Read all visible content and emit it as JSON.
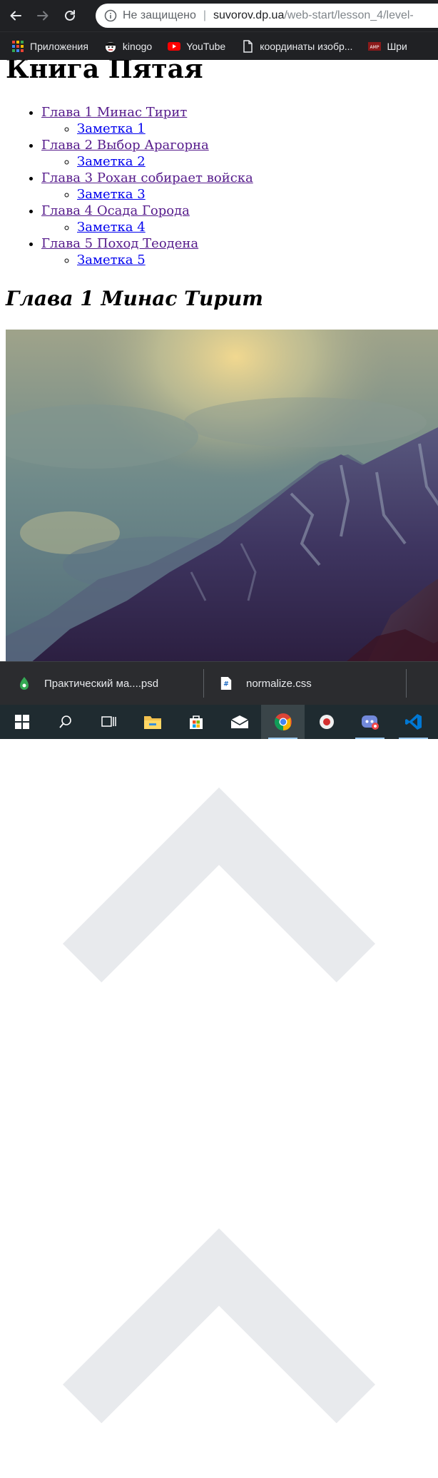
{
  "browser": {
    "security_label": "Не защищено",
    "url_host": "suvorov.dp.ua",
    "url_path": "/web-start/lesson_4/level-"
  },
  "bookmarks": [
    {
      "label": "Приложения",
      "icon": "apps-grid-icon"
    },
    {
      "label": "kinogo",
      "icon": "kinogo-favicon-icon"
    },
    {
      "label": "YouTube",
      "icon": "youtube-icon"
    },
    {
      "label": "координаты изобр...",
      "icon": "document-icon"
    },
    {
      "label": "Шри",
      "icon": "amp-favicon-icon"
    }
  ],
  "page": {
    "title": "Книга Пятая",
    "toc": [
      {
        "chapter": "Глава 1 Минас Тирит",
        "note": "Заметка 1"
      },
      {
        "chapter": "Глава 2 Выбор Арагорна",
        "note": "Заметка 2"
      },
      {
        "chapter": "Глава 3 Рохан собирает войска",
        "note": "Заметка 3"
      },
      {
        "chapter": "Глава 4 Осада Города",
        "note": "Заметка 4"
      },
      {
        "chapter": "Глава 5 Поход Теодена",
        "note": "Заметка 5"
      }
    ],
    "section_heading": "Глава 1 Минас Тирит",
    "image_subject": "mountain-landscape-photo"
  },
  "downloads": [
    {
      "name": "Практический ма....psd",
      "icon": "psd-file-icon"
    },
    {
      "name": "normalize.css",
      "icon": "css-file-icon"
    }
  ],
  "taskbar": [
    "windows-start-icon",
    "search-icon",
    "task-view-icon",
    "file-explorer-icon",
    "store-icon",
    "mail-icon",
    "chrome-icon",
    "app-icon",
    "discord-icon",
    "vscode-icon"
  ],
  "colors": {
    "chrome_dark": "#202124",
    "visited_link": "#551a8b",
    "link": "#0000ee",
    "taskbar": "#1f2b30"
  }
}
